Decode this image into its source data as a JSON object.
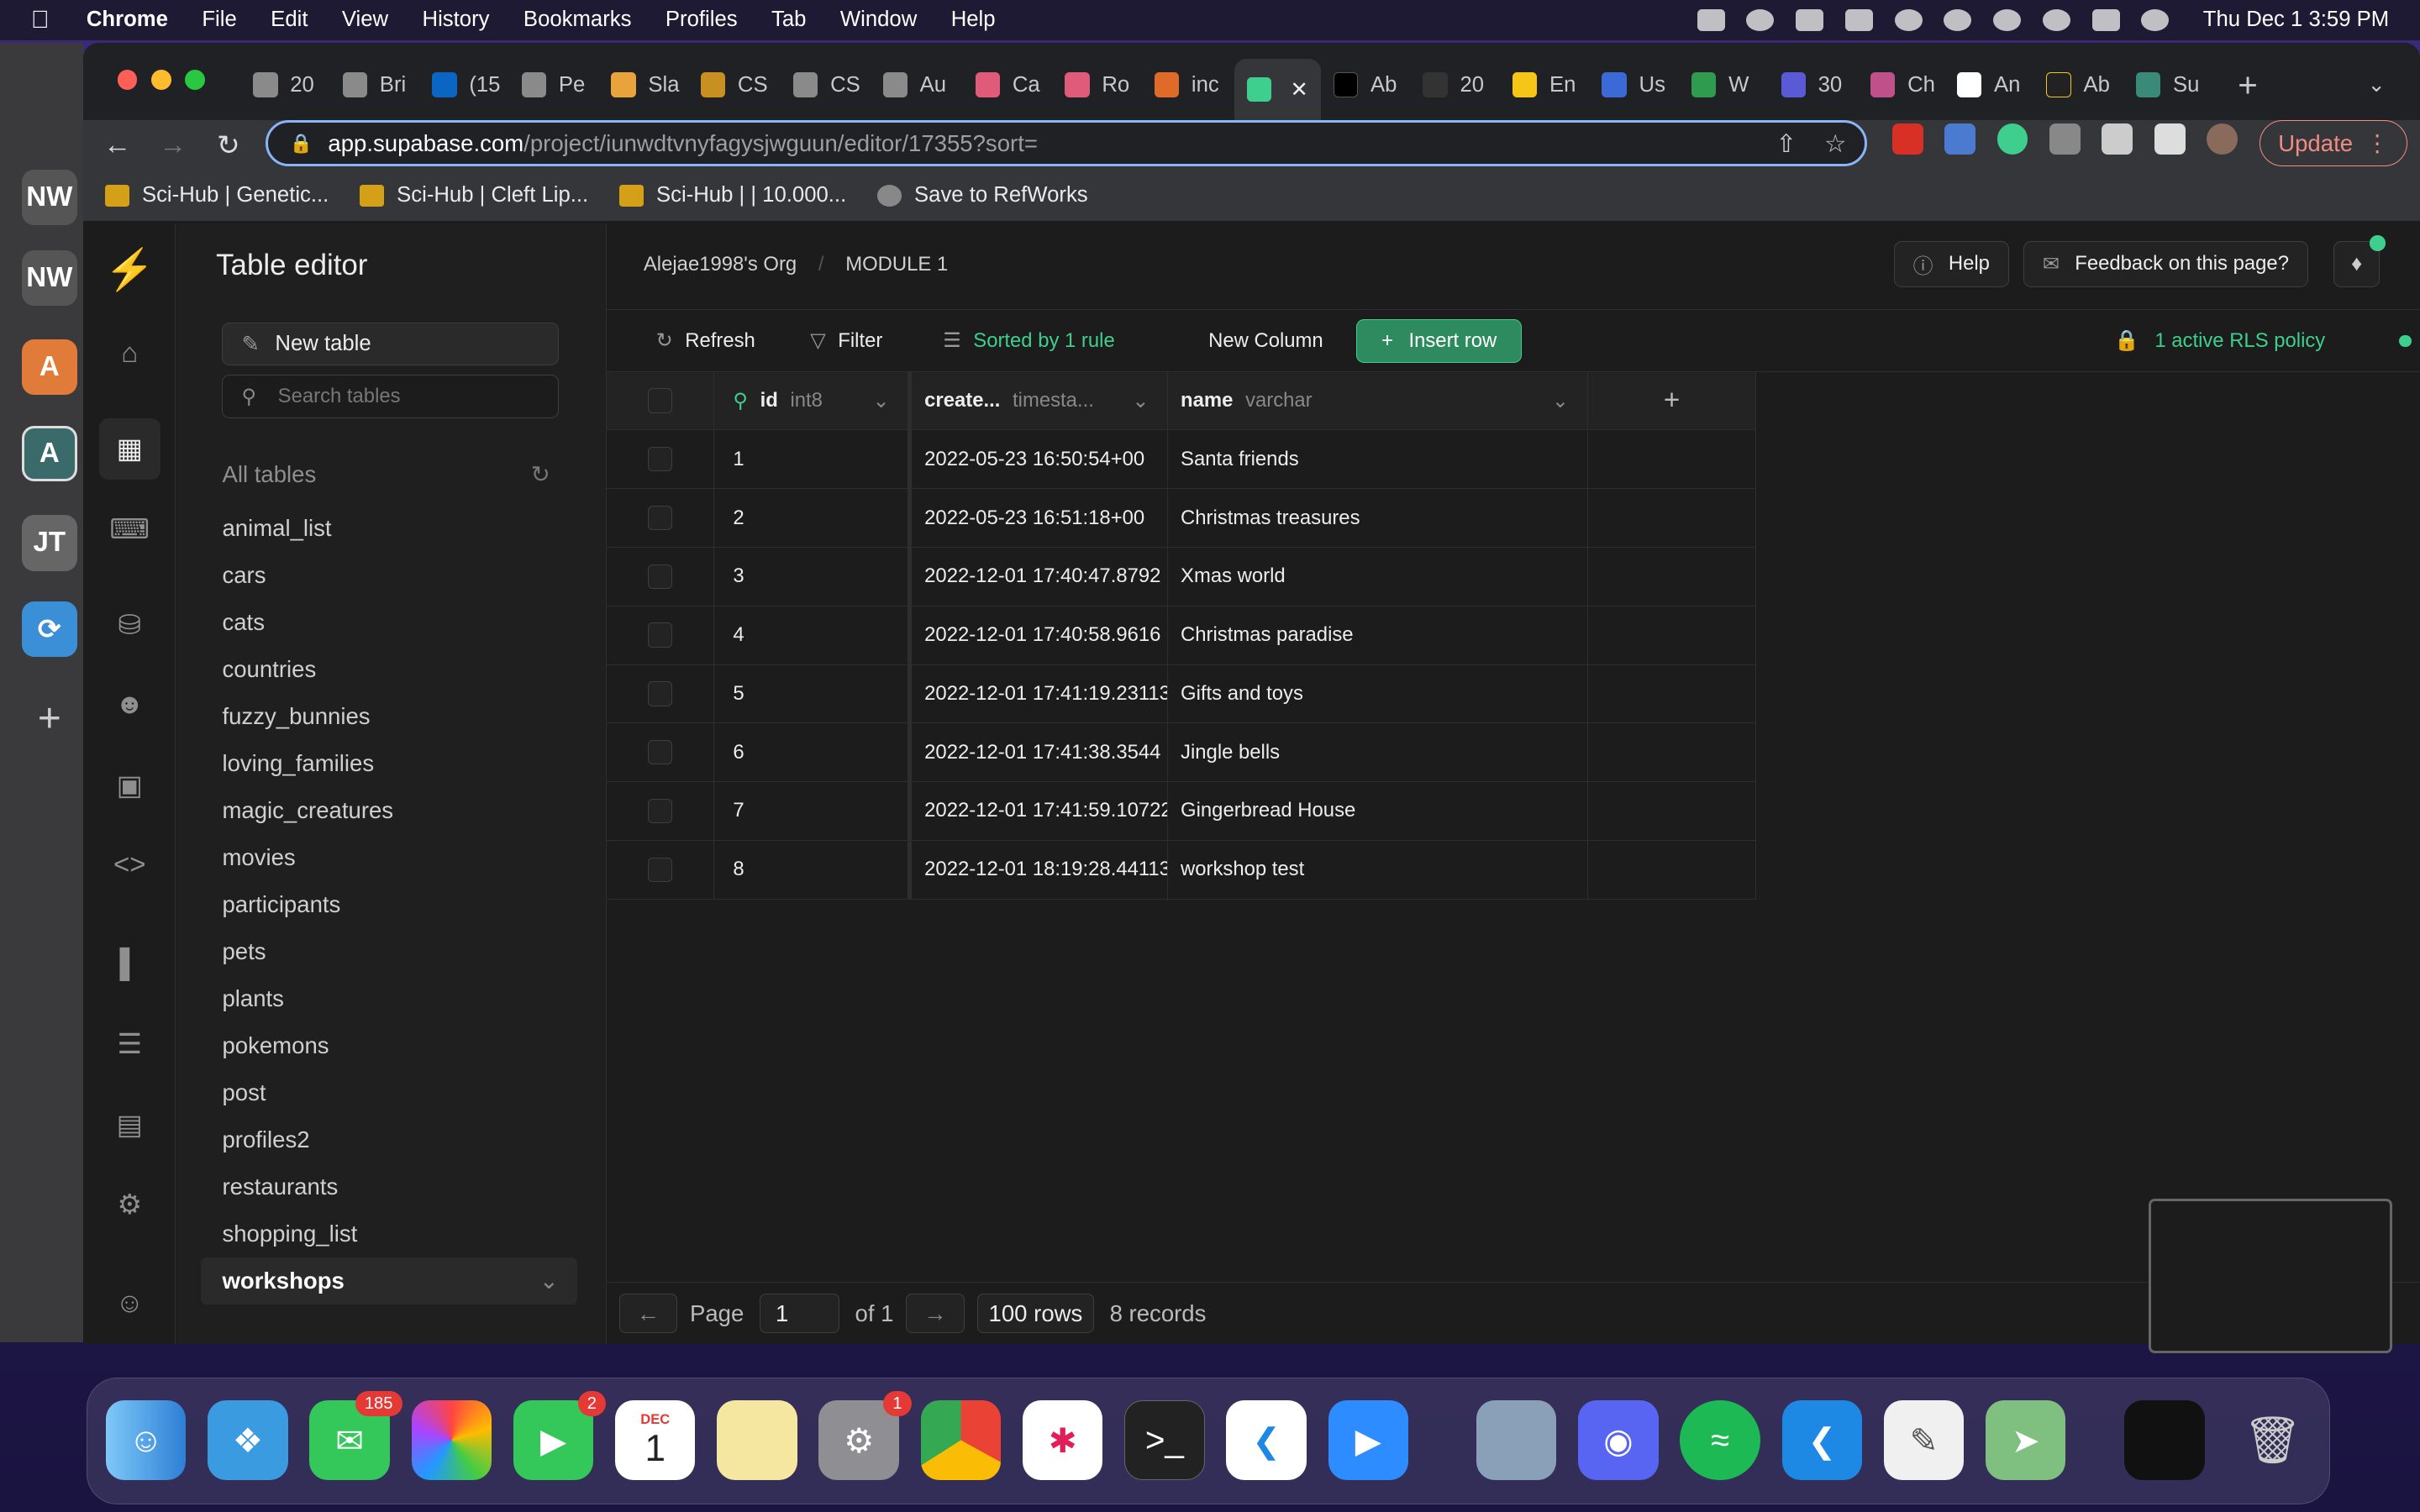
{
  "menubar": {
    "app": "Chrome",
    "items": [
      "File",
      "Edit",
      "View",
      "History",
      "Bookmarks",
      "Profiles",
      "Tab",
      "Window",
      "Help"
    ],
    "datetime": "Thu Dec 1  3:59 PM"
  },
  "tabs": [
    "20",
    "Bri",
    "(15",
    "Pe",
    "Sla",
    "CS",
    "CS",
    "Au",
    "Ca",
    "Ro",
    "inc",
    "",
    "Ab",
    "20",
    "En",
    "Us",
    "W",
    "30",
    "Ch",
    "An",
    "Ab",
    "Su"
  ],
  "browser": {
    "url_host": "app.supabase.com",
    "url_path": "/project/iunwdtvnyfagysjwguun/editor/17355?sort=",
    "update_label": "Update"
  },
  "bookmarks": [
    "Sci-Hub | Genetic...",
    "Sci-Hub | Cleft Lip...",
    "Sci-Hub | | 10.000...",
    "Save to RefWorks"
  ],
  "sidebar": {
    "title": "Table editor",
    "new_table": "New table",
    "search_placeholder": "Search tables",
    "all_tables": "All tables",
    "tables": [
      "animal_list",
      "cars",
      "cats",
      "countries",
      "fuzzy_bunnies",
      "loving_families",
      "magic_creatures",
      "movies",
      "participants",
      "pets",
      "plants",
      "pokemons",
      "post",
      "profiles2",
      "restaurants",
      "shopping_list"
    ],
    "selected": "workshops"
  },
  "header": {
    "org": "Alejae1998's Org",
    "project": "MODULE 1",
    "help": "Help",
    "feedback": "Feedback on this page?"
  },
  "gridbar": {
    "refresh": "Refresh",
    "filter": "Filter",
    "sorted": "Sorted by 1 rule",
    "new_column": "New Column",
    "insert_row": "Insert row",
    "rls": "1 active RLS policy"
  },
  "columns": [
    {
      "name": "id",
      "type": "int8"
    },
    {
      "name": "create...",
      "type": "timesta..."
    },
    {
      "name": "name",
      "type": "varchar"
    }
  ],
  "rows": [
    {
      "id": "1",
      "created": "2022-05-23 16:50:54+00",
      "name": "Santa friends"
    },
    {
      "id": "2",
      "created": "2022-05-23 16:51:18+00",
      "name": "Christmas treasures"
    },
    {
      "id": "3",
      "created": "2022-12-01 17:40:47.8792",
      "name": "Xmas world"
    },
    {
      "id": "4",
      "created": "2022-12-01 17:40:58.9616",
      "name": "Christmas paradise"
    },
    {
      "id": "5",
      "created": "2022-12-01 17:41:19.23113",
      "name": "Gifts and toys"
    },
    {
      "id": "6",
      "created": "2022-12-01 17:41:38.3544",
      "name": "Jingle bells"
    },
    {
      "id": "7",
      "created": "2022-12-01 17:41:59.10722",
      "name": "Gingerbread House"
    },
    {
      "id": "8",
      "created": "2022-12-01 18:19:28.44113",
      "name": "workshop test"
    }
  ],
  "footer": {
    "page_label": "Page",
    "page_value": "1",
    "of": "of 1",
    "rows_per_page": "100 rows",
    "records": "8 records"
  },
  "dock": {
    "messages_badge": "185",
    "facetime_badge": "2",
    "settings_badge": "1",
    "calendar_month": "DEC",
    "calendar_day": "1"
  },
  "colors": {
    "brand": "#3ecf8e",
    "bg": "#1c1c1c"
  }
}
